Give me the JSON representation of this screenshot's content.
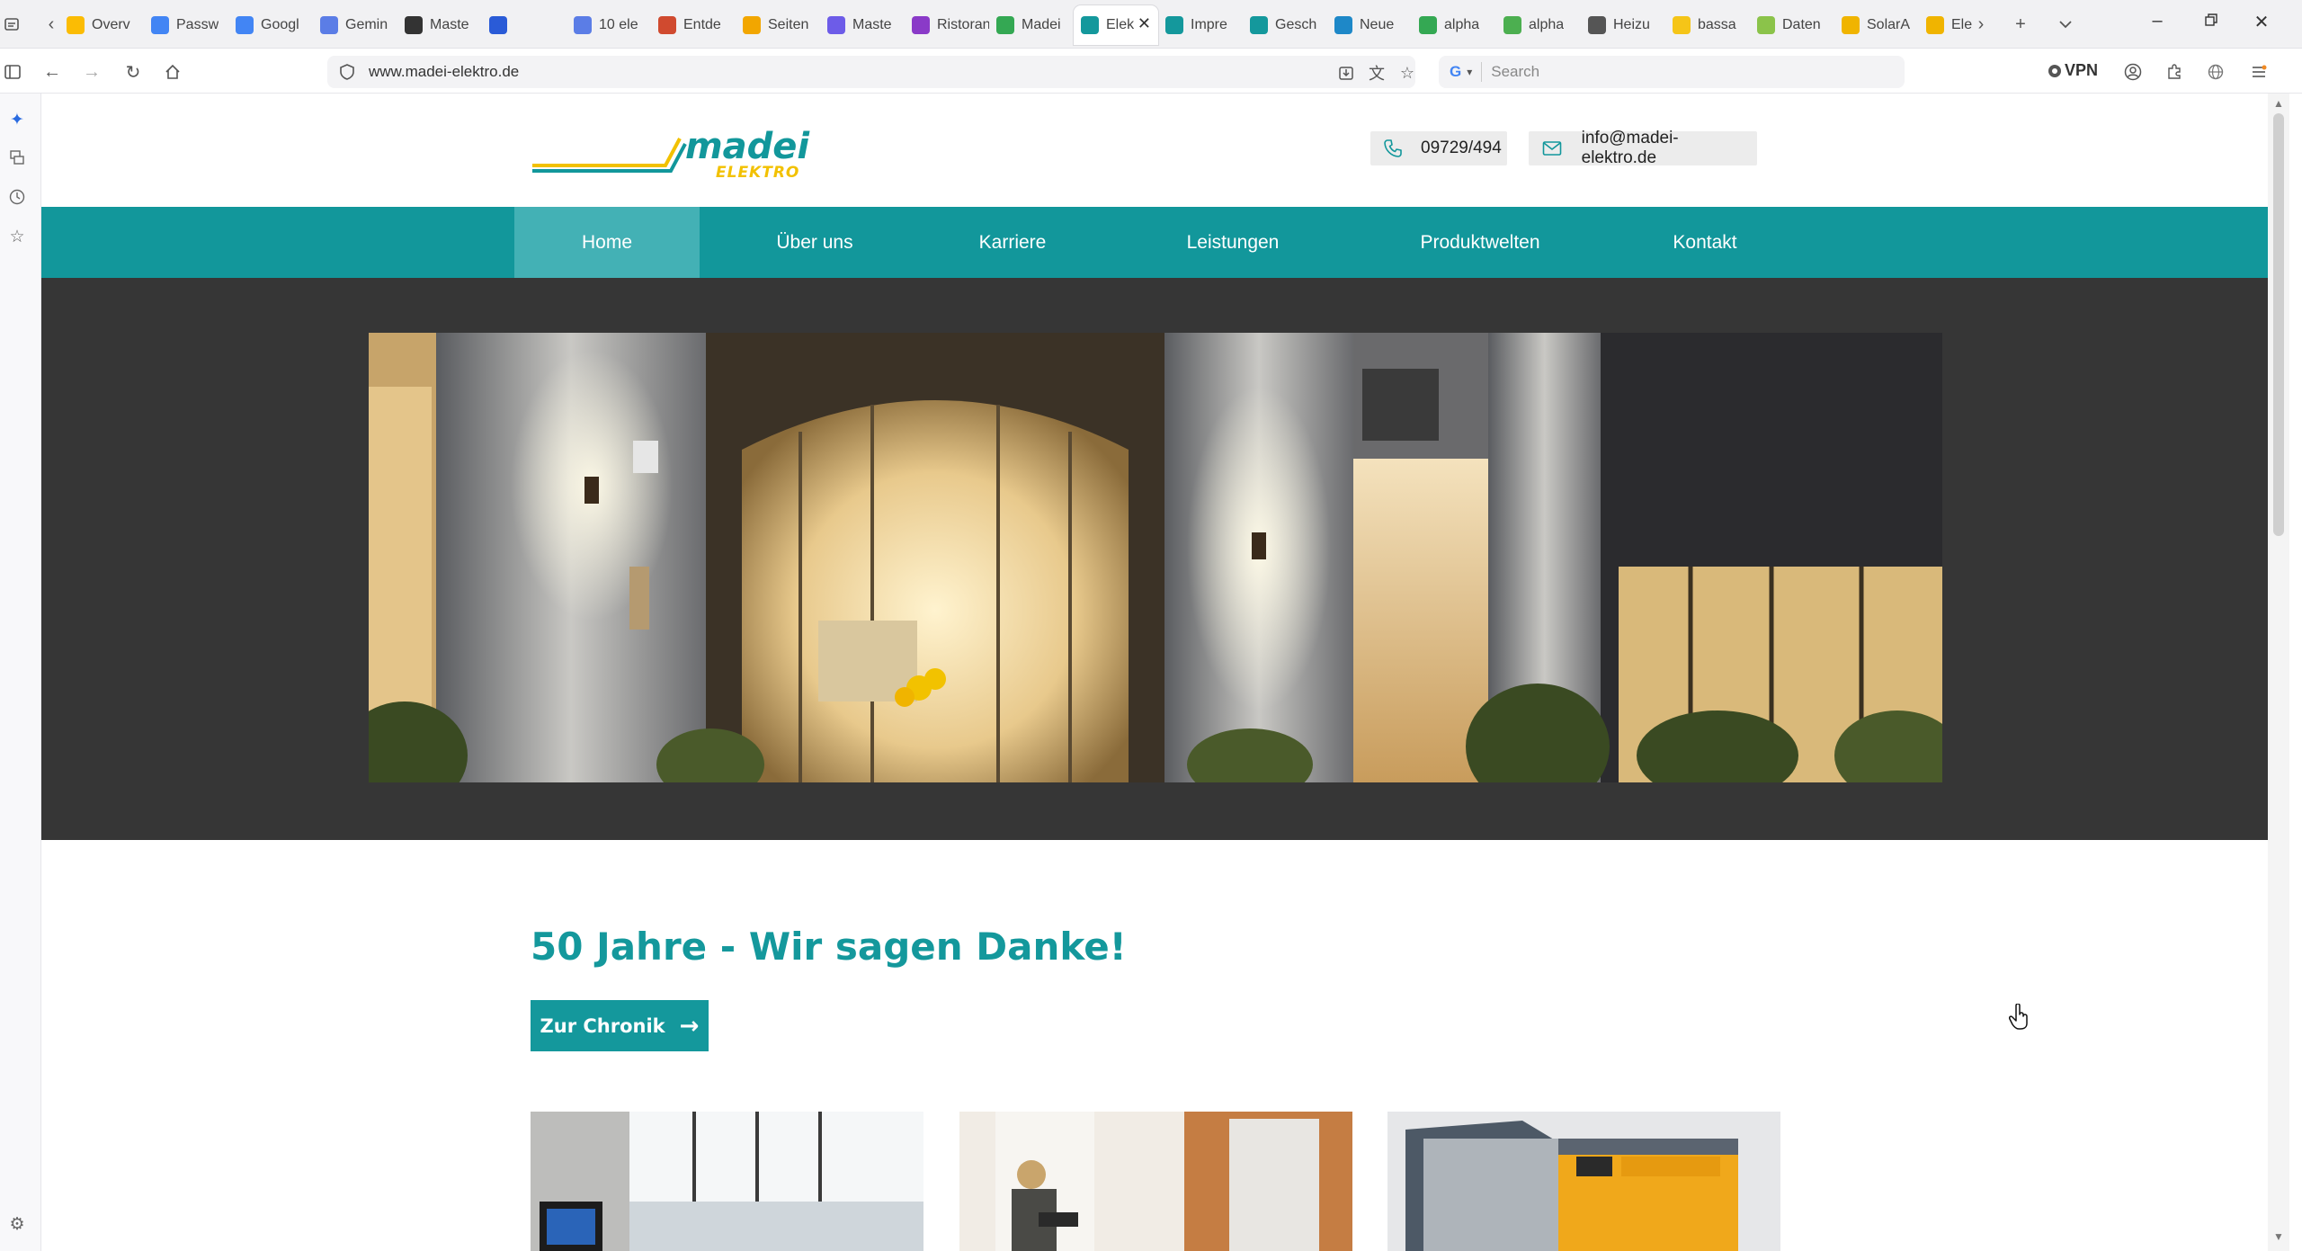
{
  "browser": {
    "tabs": [
      {
        "label": "Overv",
        "icon": "google-ads-icon",
        "color": "#fbbc04"
      },
      {
        "label": "Passw",
        "icon": "google-g-icon",
        "color": "#4285f4"
      },
      {
        "label": "Googl",
        "icon": "google-g-icon",
        "color": "#4285f4"
      },
      {
        "label": "Gemin",
        "icon": "gemini-icon",
        "color": "#5b7de6"
      },
      {
        "label": "Maste",
        "icon": "document-icon",
        "color": "#333333"
      },
      {
        "label": "",
        "icon": "app-square-icon",
        "color": "#2a5bd7"
      },
      {
        "label": "10 ele",
        "icon": "gemini-icon",
        "color": "#5b7de6"
      },
      {
        "label": "Entde",
        "icon": "trend-icon",
        "color": "#d04a2f"
      },
      {
        "label": "Seiten",
        "icon": "analytics-icon",
        "color": "#f2a600"
      },
      {
        "label": "Maste",
        "icon": "bot-icon",
        "color": "#6d5ce8"
      },
      {
        "label": "Ristorante",
        "icon": "purple-square-icon",
        "color": "#8a3ac8"
      },
      {
        "label": "Madei",
        "icon": "maps-pin-icon",
        "color": "#34a853"
      },
      {
        "label": "Elek",
        "icon": "madei-m-icon",
        "color": "#14989c"
      },
      {
        "label": "Impre",
        "icon": "madei-m-icon",
        "color": "#14989c"
      },
      {
        "label": "Gesch",
        "icon": "madei-m-icon",
        "color": "#14989c"
      },
      {
        "label": "Neue",
        "icon": "page-builder-icon",
        "color": "#1e88c8"
      },
      {
        "label": "alpha",
        "icon": "maps-pin-icon",
        "color": "#34a853"
      },
      {
        "label": "alpha",
        "icon": "circle-logo-icon",
        "color": "#4caf50"
      },
      {
        "label": "Heizu",
        "icon": "cursor-icon",
        "color": "#555555"
      },
      {
        "label": "bassa",
        "icon": "honey-icon",
        "color": "#f5c518"
      },
      {
        "label": "Daten",
        "icon": "heart-icon",
        "color": "#8bc34a"
      },
      {
        "label": "SolarA",
        "icon": "sun-icon",
        "color": "#f0b400"
      },
      {
        "label": "Ele",
        "icon": "sun-icon",
        "color": "#f0b400"
      }
    ],
    "active_tab_index": 12,
    "url": "www.madei-elektro.de",
    "search_placeholder": "Search",
    "search_engine": "G",
    "vpn_label": "VPN"
  },
  "site": {
    "logo": {
      "brand": "madei",
      "sub": "ELEKTRO"
    },
    "phone": "09729/494",
    "email": "info@madei-elektro.de",
    "menu": [
      {
        "label": "Home",
        "active": true
      },
      {
        "label": "Über uns",
        "active": false
      },
      {
        "label": "Karriere",
        "active": false
      },
      {
        "label": "Leistungen",
        "active": false
      },
      {
        "label": "Produktwelten",
        "active": false
      },
      {
        "label": "Kontakt",
        "active": false
      }
    ],
    "headline": "50 Jahre - Wir sagen Danke!",
    "cta_label": "Zur Chronik",
    "colors": {
      "primary": "#12979b",
      "active": "#43b1b5",
      "hero_bg": "#363636",
      "logo_yellow": "#f2c100"
    }
  }
}
